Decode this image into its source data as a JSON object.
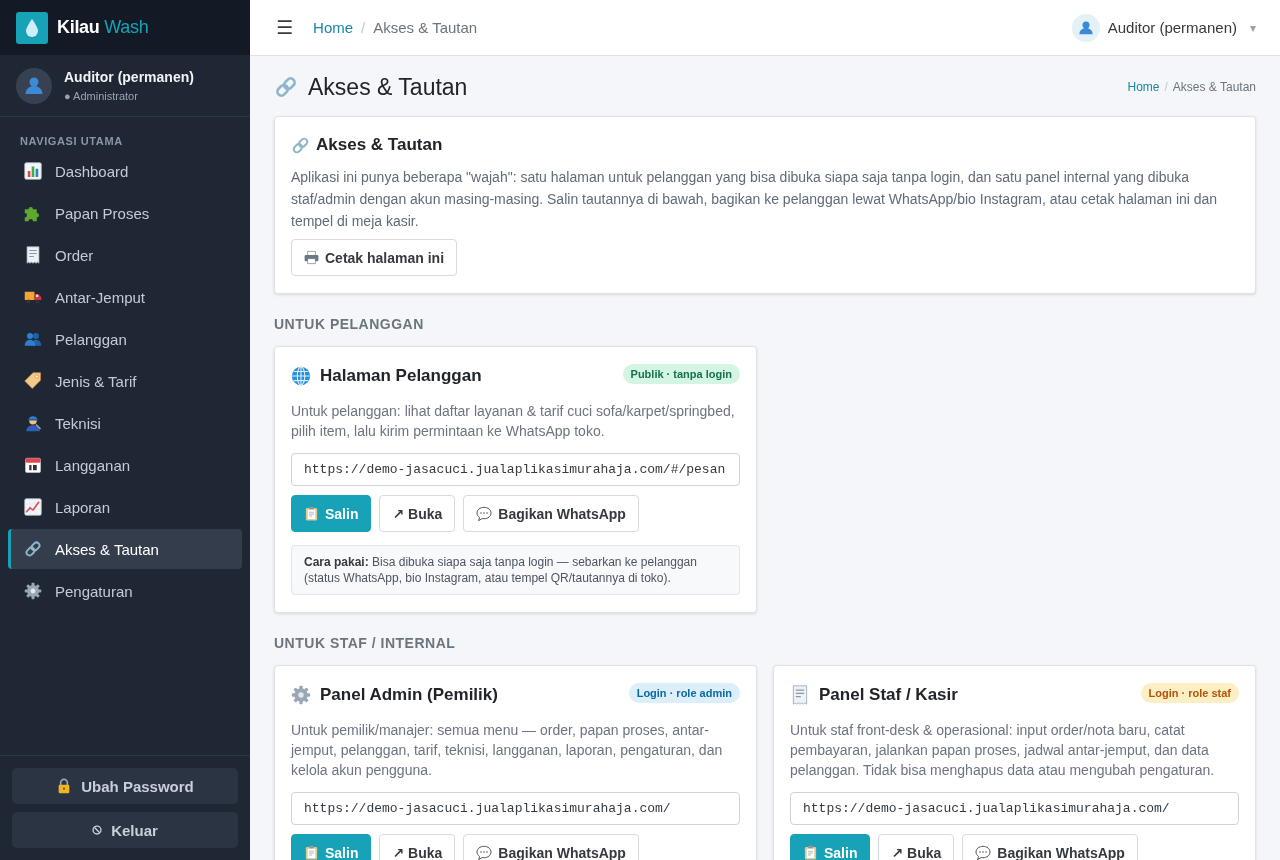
{
  "brand": {
    "name": "**Kilau** Wash"
  },
  "sidebar": {
    "user": {
      "name": "Auditor (permanen)",
      "role": "● Administrator"
    },
    "nav_title": "NAVIGASI UTAMA",
    "items": [
      {
        "label": "Dashboard",
        "selected": false
      },
      {
        "label": "Papan Proses",
        "selected": false
      },
      {
        "label": "Order",
        "selected": false
      },
      {
        "label": "Antar-Jemput",
        "selected": false
      },
      {
        "label": "Pelanggan",
        "selected": false
      },
      {
        "label": "Jenis & Tarif",
        "selected": false
      },
      {
        "label": "Teknisi",
        "selected": false
      },
      {
        "label": "Langganan",
        "selected": false
      },
      {
        "label": "Laporan",
        "selected": false
      },
      {
        "label": "Akses & Tautan",
        "selected": true
      },
      {
        "label": "Pengaturan",
        "selected": false
      }
    ],
    "footer_buttons": [
      "Ubah Password",
      "Keluar"
    ]
  },
  "topbar": {
    "menu_button": "☰",
    "breadcrumb": {
      "separator": "/",
      "items": [
        {
          "label": "Home",
          "kind": "link"
        },
        {
          "label": "Akses & Tautan",
          "kind": "current"
        }
      ]
    },
    "user": {
      "name": "Auditor (permanen)",
      "caret": "▾"
    }
  },
  "page": {
    "title": "Akses & Tautan",
    "breadcrumb": {
      "separator": "/",
      "items": [
        {
          "label": "Home",
          "kind": "link"
        },
        {
          "label": "Akses & Tautan",
          "kind": "current"
        }
      ]
    }
  },
  "intro_card": {
    "title": "Akses & Tautan",
    "text": "Aplikasi ini punya beberapa \"wajah\": satu halaman untuk pelanggan yang bisa dibuka siapa saja tanpa login, dan satu panel internal yang dibuka staf/admin dengan akun masing-masing. Salin tautannya di bawah, bagikan ke pelanggan lewat WhatsApp/bio Instagram, atau cetak halaman ini dan tempel di meja kasir.",
    "button": "Cetak halaman ini"
  },
  "sections": [
    {
      "heading": "UNTUK PELANGGAN",
      "cards": [
        {
          "title": "Halaman Pelanggan",
          "badge": {
            "label": "Publik · tanpa login",
            "kind": "public"
          },
          "description": "Untuk pelanggan: lihat daftar layanan & tarif cuci sofa/karpet/springbed, pilih item, lalu kirim permintaan ke WhatsApp toko.",
          "url": "https://demo-jasacuci.jualaplikasimurahaja.com/#/pesan",
          "buttons": [
            {
              "label": "Salin",
              "kind": "copy"
            },
            {
              "label": "↗ Buka",
              "kind": "open"
            },
            {
              "label": "Bagikan WhatsApp",
              "kind": "share"
            }
          ],
          "note": "**Cara pakai:** Bisa dibuka siapa saja tanpa login — sebarkan ke pelanggan (status WhatsApp, bio Instagram, atau tempel QR/tautannya di toko)."
        }
      ]
    },
    {
      "heading": "UNTUK STAF / INTERNAL",
      "cards": [
        {
          "title": "Panel Admin (Pemilik)",
          "badge": {
            "label": "Login · role admin",
            "kind": "admin"
          },
          "description": "Untuk pemilik/manajer: semua menu — order, papan proses, antar-jemput, pelanggan, tarif, teknisi, langganan, laporan, pengaturan, dan kelola akun pengguna.",
          "url": "https://demo-jasacuci.jualaplikasimurahaja.com/",
          "buttons": [
            {
              "label": "Salin",
              "kind": "copy"
            },
            {
              "label": "↗ Buka",
              "kind": "open"
            },
            {
              "label": "Bagikan WhatsApp",
              "kind": "share"
            }
          ]
        },
        {
          "title": "Panel Staf / Kasir",
          "badge": {
            "label": "Login · role staf",
            "kind": "staff"
          },
          "description": "Untuk staf front-desk & operasional: input order/nota baru, catat pembayaran, jalankan papan proses, jadwal antar-jemput, dan data pelanggan. Tidak bisa menghapus data atau mengubah pengaturan.",
          "url": "https://demo-jasacuci.jualaplikasimurahaja.com/",
          "buttons": [
            {
              "label": "Salin",
              "kind": "copy"
            },
            {
              "label": "↗ Buka",
              "kind": "open"
            },
            {
              "label": "Bagikan WhatsApp",
              "kind": "share"
            }
          ]
        }
      ]
    }
  ]
}
